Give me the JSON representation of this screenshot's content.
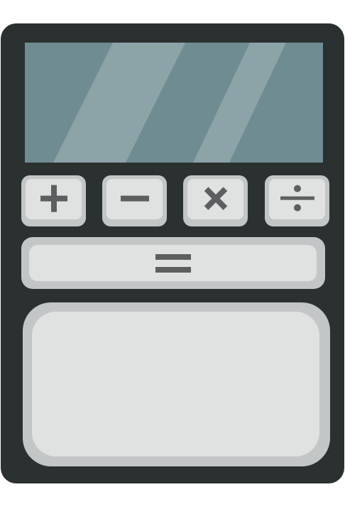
{
  "colors": {
    "body": "#2b3031",
    "screen": "#6f8c92",
    "screen_shine": "#8ca3a8",
    "key_dark": "#c3c6c6",
    "key_light": "#e0e2e2",
    "glyph": "#5b5f60"
  },
  "display": {
    "value": ""
  },
  "keys": [
    {
      "name": "plus",
      "icon": "plus-icon"
    },
    {
      "name": "minus",
      "icon": "minus-icon"
    },
    {
      "name": "times",
      "icon": "multiply-icon"
    },
    {
      "name": "divide",
      "icon": "divide-icon"
    }
  ],
  "equals": {
    "icon": "equals-icon"
  }
}
